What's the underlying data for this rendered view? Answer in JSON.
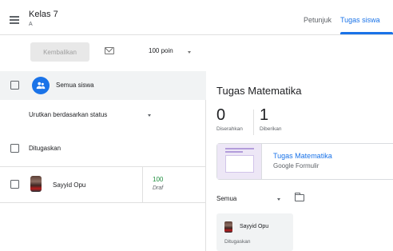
{
  "header": {
    "class_name": "Kelas 7",
    "section": "A",
    "tabs": [
      {
        "label": "Petunjuk",
        "active": false
      },
      {
        "label": "Tugas siswa",
        "active": true
      }
    ],
    "accent_color": "#1a73e8"
  },
  "toolbar": {
    "return_label": "Kembalikan",
    "points_value": "100 poin"
  },
  "left": {
    "all_students_label": "Semua siswa",
    "sort_label": "Urutkan berdasarkan status",
    "group_label": "Ditugaskan",
    "students": [
      {
        "name": "Sayyid Opu",
        "grade": "100",
        "grade_status": "Draf"
      }
    ]
  },
  "right": {
    "assignment_title": "Tugas Matematika",
    "stats": [
      {
        "number": "0",
        "label": "Diserahkan"
      },
      {
        "number": "1",
        "label": "Diberikan"
      }
    ],
    "attachment": {
      "title": "Tugas Matematika",
      "type": "Google Formulir"
    },
    "filter_label": "Semua",
    "student_card": {
      "name": "Sayyid Opu",
      "status": "Ditugaskan"
    }
  },
  "icons": [
    "menu-icon",
    "mail-icon",
    "people-icon",
    "dropdown-arrow-icon",
    "folder-icon"
  ]
}
